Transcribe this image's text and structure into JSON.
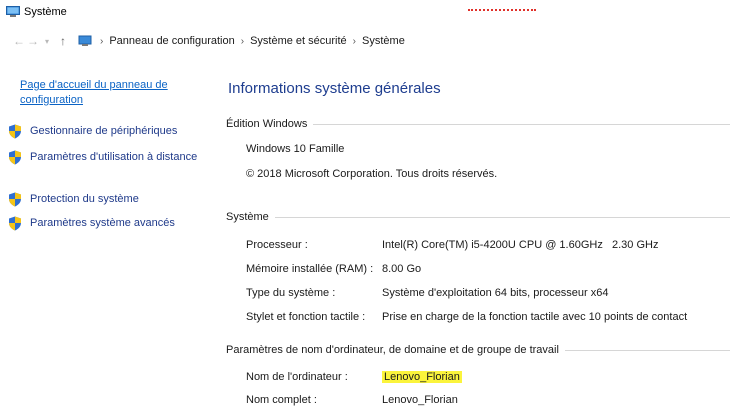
{
  "window": {
    "title": "Système"
  },
  "addressbar": {
    "back_icon": "arrow-left-icon",
    "forward_icon": "arrow-right-icon",
    "recent_icon": "chevron-down-icon",
    "up_icon": "arrow-up-icon",
    "crumbs": [
      "Panneau de configuration",
      "Système et sécurité",
      "Système"
    ],
    "separator": "›"
  },
  "sidebar": {
    "home_link": "Page d'accueil du panneau de configuration",
    "items": [
      {
        "label": "Gestionnaire de périphériques",
        "icon": "shield-icon"
      },
      {
        "label": "Paramètres d'utilisation à distance",
        "icon": "shield-icon"
      },
      {
        "label": "Protection du système",
        "icon": "shield-icon"
      },
      {
        "label": "Paramètres système avancés",
        "icon": "shield-icon"
      }
    ]
  },
  "main": {
    "title": "Informations système générales",
    "edition": {
      "header": "Édition Windows",
      "name": "Windows 10 Famille",
      "copyright": "© 2018 Microsoft Corporation. Tous droits réservés."
    },
    "system": {
      "header": "Système",
      "rows": [
        {
          "key": "Processeur :",
          "value": "Intel(R) Core(TM) i5-4200U CPU @ 1.60GHz   2.30 GHz"
        },
        {
          "key": "Mémoire installée (RAM) :",
          "value": "8.00 Go"
        },
        {
          "key": "Type du système :",
          "value": "Système d'exploitation 64 bits, processeur x64"
        },
        {
          "key": "Stylet et fonction tactile :",
          "value": "Prise en charge de la fonction tactile avec 10 points de contact"
        }
      ]
    },
    "computer_name": {
      "header": "Paramètres de nom d'ordinateur, de domaine et de groupe de travail",
      "rows": [
        {
          "key": "Nom de l'ordinateur :",
          "value": "Lenovo_Florian"
        },
        {
          "key": "Nom complet :",
          "value": "Lenovo_Florian"
        }
      ]
    }
  },
  "colors": {
    "link": "#0b63c5",
    "title": "#1e3d8f",
    "highlight": "#fbf43c"
  }
}
